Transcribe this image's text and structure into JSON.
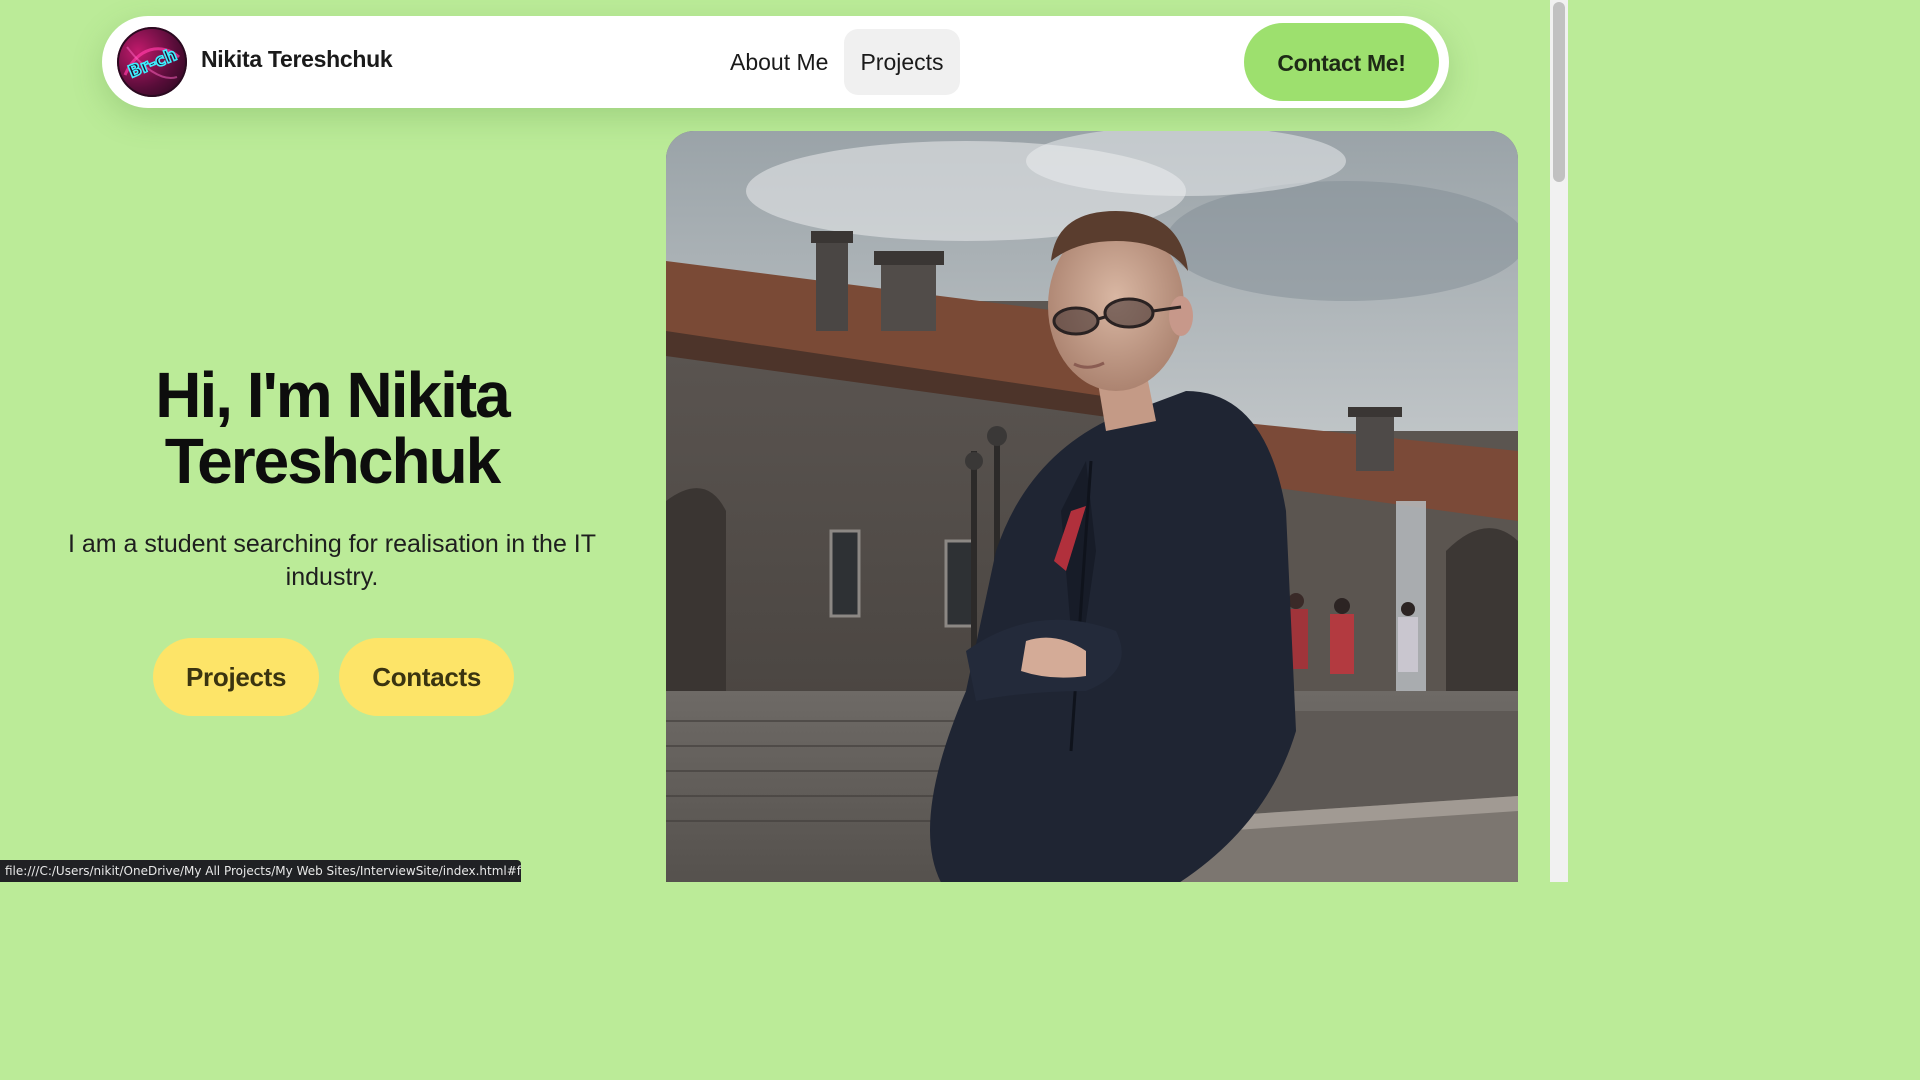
{
  "nav": {
    "brand_name": "Nikita Tereshchuk",
    "logo_text": "Br-ch",
    "links": [
      {
        "label": "About Me"
      },
      {
        "label": "Projects",
        "active": true
      }
    ],
    "contact_label": "Contact Me!"
  },
  "hero": {
    "title_line1": "Hi, I'm Nikita",
    "title_line2": "Tereshchuk",
    "subtitle": "I am a student searching for realisation in the IT industry.",
    "buttons": [
      {
        "label": "Projects"
      },
      {
        "label": "Contacts"
      }
    ]
  },
  "status_bar": {
    "url": "file:///C:/Users/nikit/OneDrive/My All Projects/My Web Sites/InterviewSite/index.html#featur..."
  },
  "colors": {
    "page_background": "#bbeb98",
    "contact_button": "#9de06e",
    "hero_buttons": "#fde468",
    "navbar": "#ffffff"
  }
}
